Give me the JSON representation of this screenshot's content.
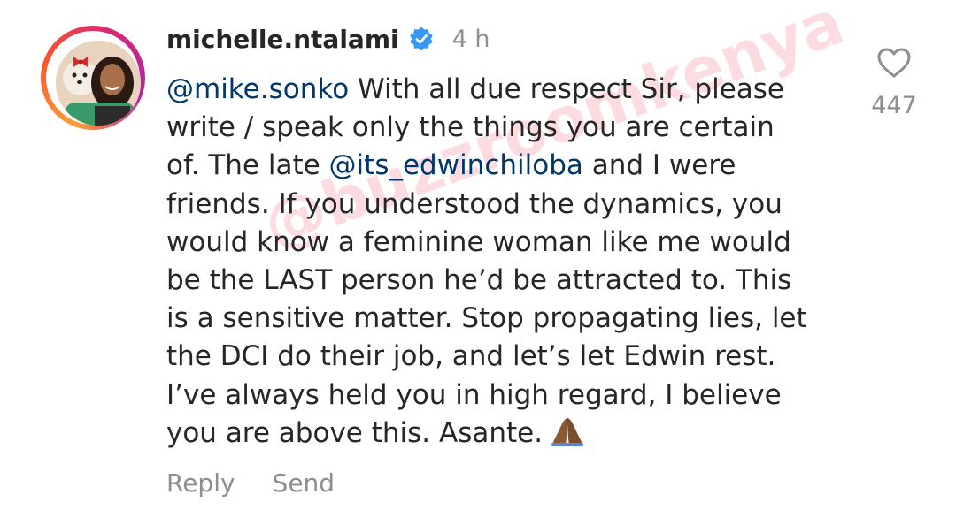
{
  "comment": {
    "username": "michelle.ntalami",
    "timestamp": "4 h",
    "verified_icon": "verified-badge-icon",
    "lines": [
      {
        "mention": "@mike.sonko",
        "text": " With all due respect Sir, please"
      },
      {
        "text": "write / speak only the things you are certain"
      },
      {
        "before": "of. The late ",
        "mention": "@its_edwinchiloba",
        "after": " and I were"
      },
      {
        "text": "friends. If you understood the dynamics, you"
      },
      {
        "text": "would know a feminine woman like me would"
      },
      {
        "text": "be the LAST person he’d be attracted to. This"
      },
      {
        "text": "is a sensitive matter. Stop propagating lies, let"
      },
      {
        "text": "the DCI do their job, and let’s let Edwin rest."
      },
      {
        "text": "I’ve always held you in high regard, I believe"
      },
      {
        "text": "you are above this. Asante."
      }
    ],
    "emoji": "🙏🏾"
  },
  "actions": {
    "reply_label": "Reply",
    "send_label": "Send"
  },
  "likes": {
    "icon": "heart-outline-icon",
    "count": "447"
  },
  "watermark": "@buzzroomkenya",
  "colors": {
    "mention": "#00376b",
    "verified": "#3897f0",
    "muted": "#8e8e8e",
    "text": "#262626"
  }
}
